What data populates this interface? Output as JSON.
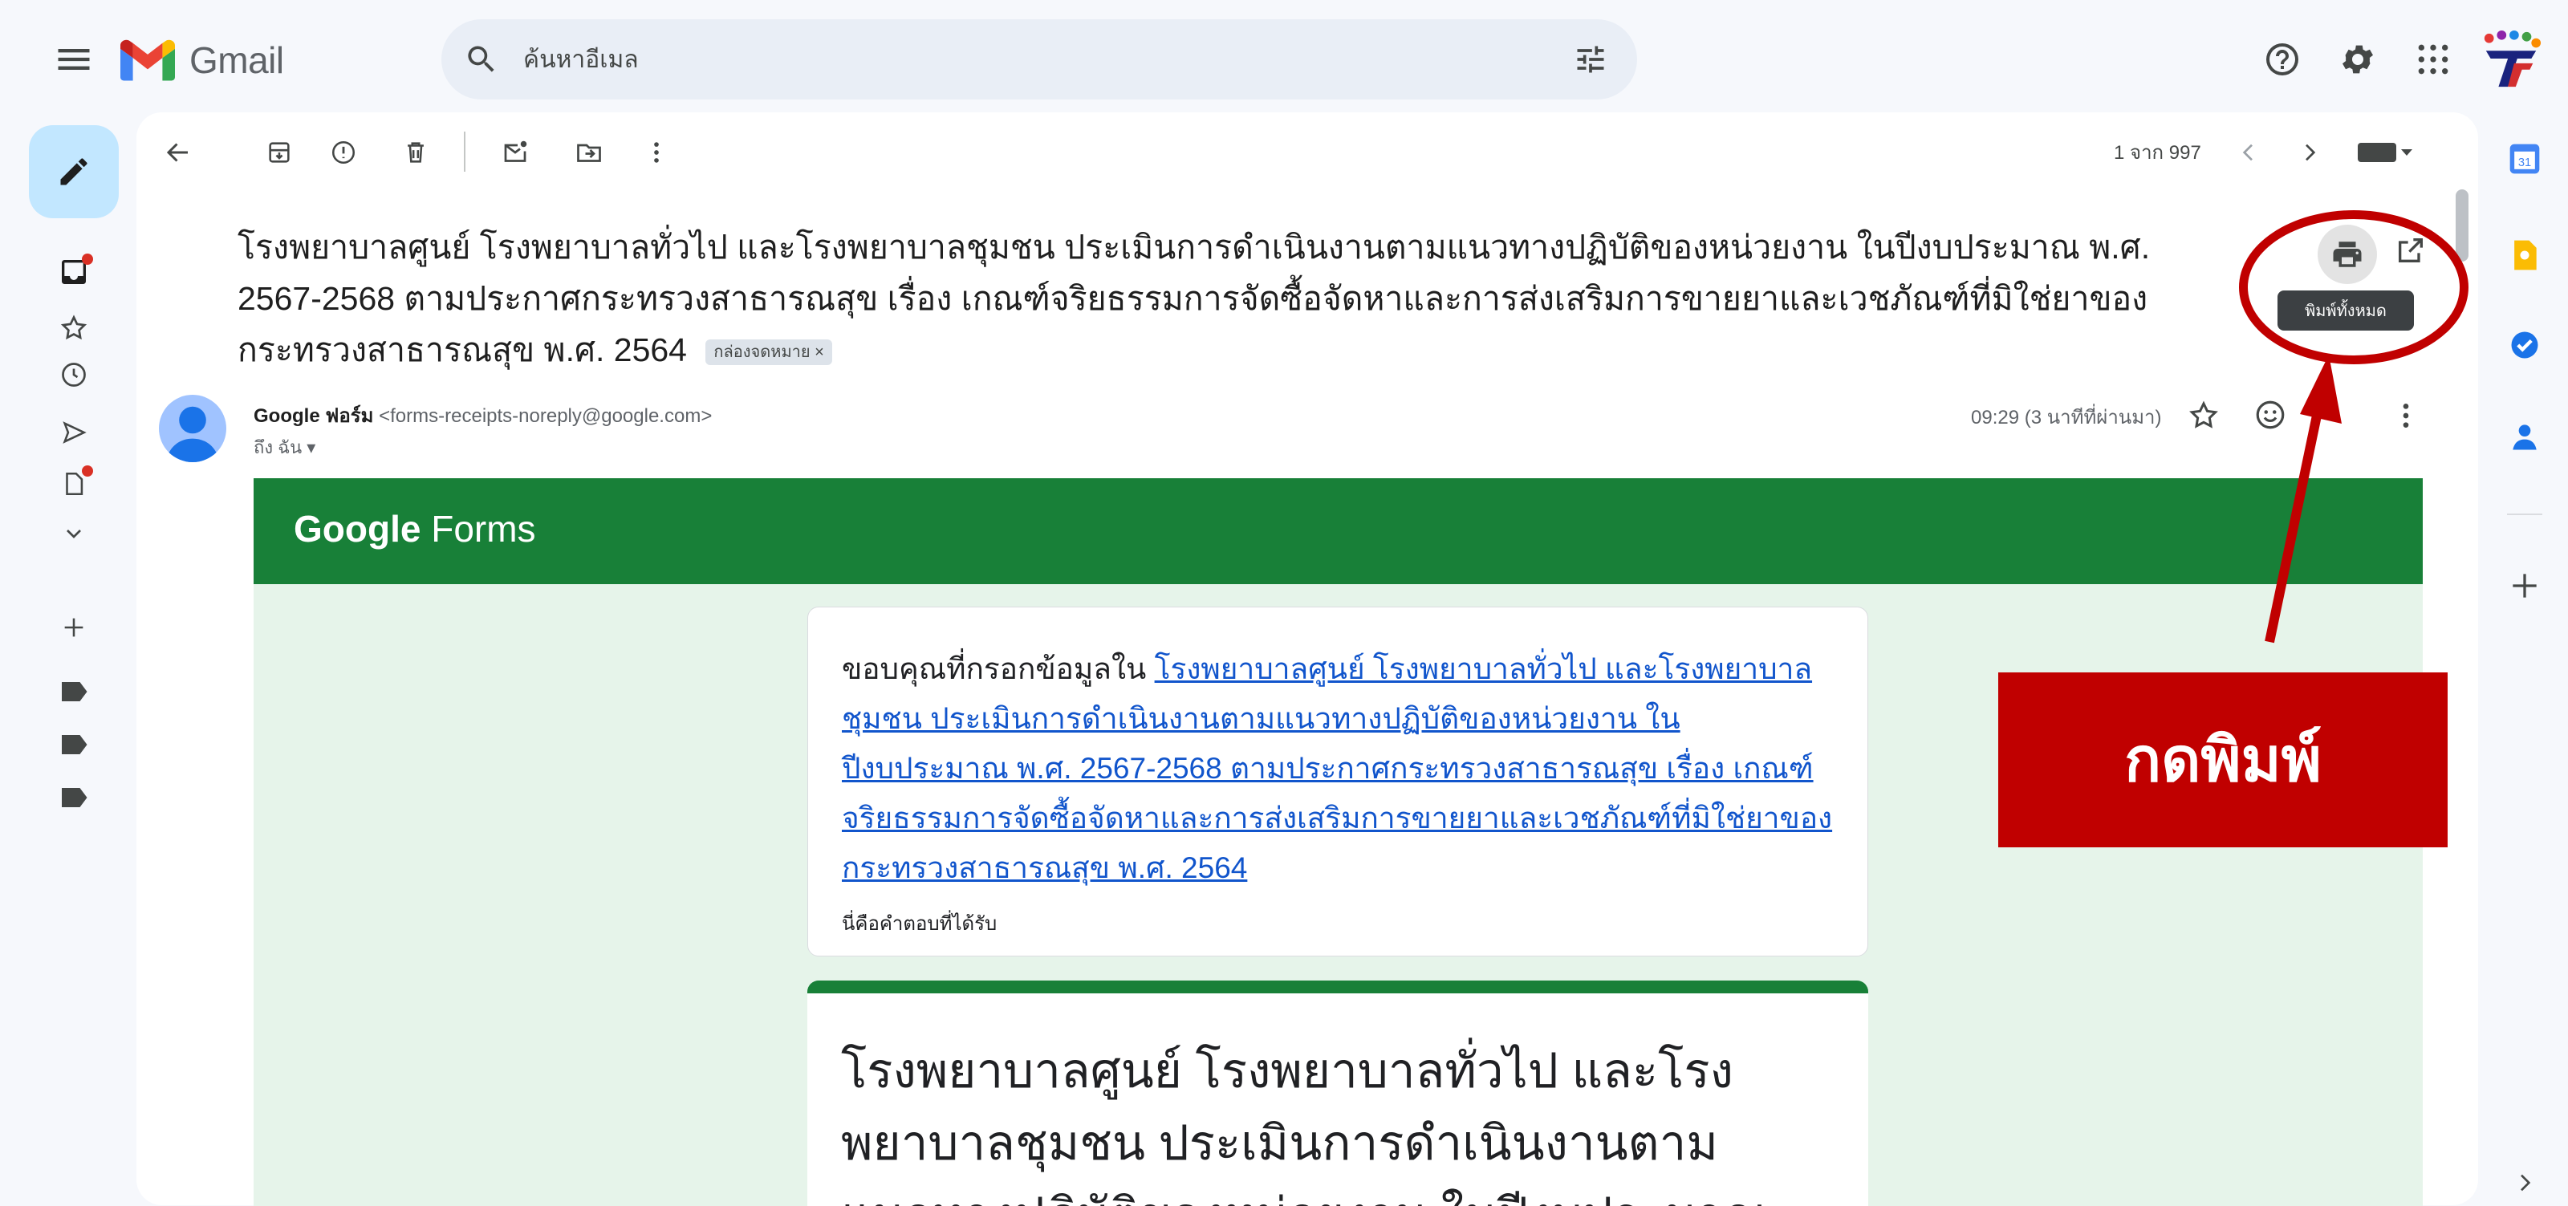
{
  "app": {
    "name": "Gmail"
  },
  "search": {
    "placeholder": "ค้นหาอีเมล"
  },
  "toolbar": {
    "pager": "1 จาก 997"
  },
  "email": {
    "subject": "โรงพยาบาลศูนย์ โรงพยาบาลทั่วไป และโรงพยาบาลชุมชน ประเมินการดำเนินงานตามแนวทางปฏิบัติของหน่วยงาน ในปีงบประมาณ พ.ศ. 2567-2568 ตามประกาศกระทรวงสาธารณสุข เรื่อง เกณฑ์จริยธรรมการจัดซื้อจัดหาและการส่งเสริมการขายยาและเวชภัณฑ์ที่มิใช่ยาของกระทรวงสาธารณสุข พ.ศ. 2564",
    "label_tag": "กล่องจดหมาย ×",
    "print_tooltip": "พิมพ์ทั้งหมด",
    "sender_name": "Google ฟอร์ม",
    "sender_email": "<forms-receipts-noreply@google.com>",
    "to": "ถึง ฉัน ▾",
    "time": "09:29 (3 นาทีที่ผ่านมา)"
  },
  "forms": {
    "logo_google": "Google",
    "logo_forms": "Forms",
    "thanks_prefix": "ขอบคุณที่กรอกข้อมูลใน ",
    "form_link": "โรงพยาบาลศูนย์ โรงพยาบาลทั่วไป และโรงพยาบาลชุมชน ประเมินการดำเนินงานตามแนวทางปฏิบัติของหน่วยงาน ในปีงบประมาณ พ.ศ. 2567-2568 ตามประกาศกระทรวงสาธารณสุข เรื่อง เกณฑ์จริยธรรมการจัดซื้อจัดหาและการส่งเสริมการขายยาและเวชภัณฑ์ที่มิใช่ยาของกระทรวงสาธารณสุข พ.ศ. 2564",
    "received_note": "นี่คือคำตอบที่ได้รับ",
    "form_title": "โรงพยาบาลศูนย์ โรงพยาบาลทั่วไป และโรงพยาบาลชุมชน ประเมินการดำเนินงานตามแนวทางปฏิบัติของหน่วยงาน ในปีงบประมาณ"
  },
  "annotation": {
    "label": "กดพิมพ์",
    "color": "#c00000"
  },
  "colors": {
    "forms_green": "#188038",
    "compose_blue": "#c2e7ff",
    "link": "#1155cc"
  },
  "icons": [
    "menu-icon",
    "gmail-logo-icon",
    "search-icon",
    "tune-icon",
    "help-icon",
    "gear-icon",
    "apps-grid-icon",
    "pencil-icon",
    "inbox-icon",
    "star-icon",
    "clock-icon",
    "send-icon",
    "draft-icon",
    "chevron-down-icon",
    "plus-icon",
    "label-icon",
    "back-arrow-icon",
    "archive-icon",
    "report-icon",
    "delete-icon",
    "mark-unread-icon",
    "move-icon",
    "more-vert-icon",
    "chevron-left-icon",
    "chevron-right-icon",
    "keyboard-icon",
    "print-icon",
    "open-new-window-icon",
    "emoji-icon",
    "calendar-icon",
    "keep-icon",
    "tasks-icon",
    "contacts-icon"
  ]
}
